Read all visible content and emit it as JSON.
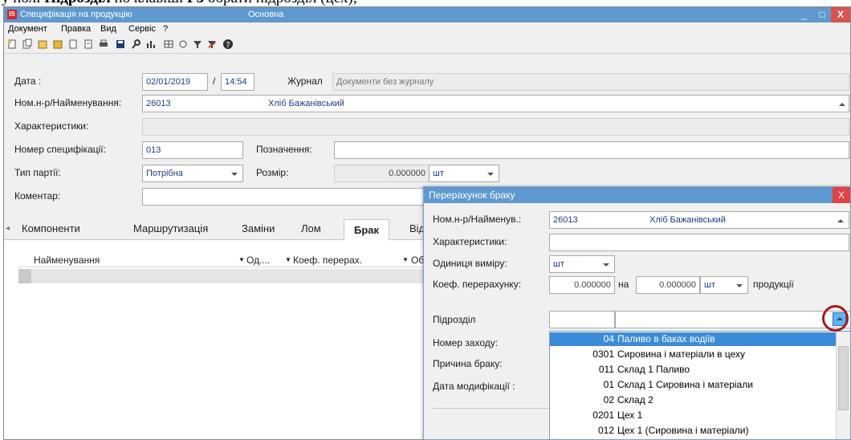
{
  "doc_strip": {
    "prefix": "у полі ",
    "bold": "Підрозділ",
    "middle": " по клавіші ",
    "bold2": "F3",
    "suffix": " обрати підрозділ (цех);"
  },
  "window": {
    "icon_text": "IS",
    "title": "Специфікація на продукцію",
    "subtitle": "Основна",
    "controls": {
      "min": "_",
      "max": "□",
      "close": "X"
    }
  },
  "menu": [
    "Документ",
    "Правка",
    "Вид",
    "Сервіс",
    "?"
  ],
  "toolbar_icons": [
    "new-doc-icon",
    "copy-doc-icon",
    "open-icon",
    "open-folder-icon",
    "doc-icon",
    "doc2-icon",
    "print-icon",
    "save-icon",
    "find-icon",
    "chart-icon",
    "grid-icon",
    "refresh-icon",
    "filter-icon",
    "clear-filter-icon",
    "help-icon"
  ],
  "form": {
    "date_label": "Дата :",
    "date_value": "02/01/2019",
    "time_sep": "/",
    "time_value": "14:54",
    "journal_label": "Журнал",
    "journal_value": "Документи без журналу",
    "item_label": "Ном.н-р/Найменування:",
    "item_code": "26013",
    "item_name": "Хліб Бажанівський",
    "characteristics_label": "Характеристики:",
    "spec_number_label": "Номер специфікації:",
    "spec_number_value": "013",
    "designation_label": "Позначення:",
    "batch_type_label": "Тип партії:",
    "batch_type_value": "Потрібна",
    "size_label": "Розмір:",
    "size_value": "0.000000",
    "size_unit": "шт",
    "comment_label": "Коментар:"
  },
  "tabs": [
    "Компоненти",
    "Маршрутизація",
    "Заміни",
    "Лом",
    "Брак",
    "Від"
  ],
  "active_tab": "Брак",
  "grid": {
    "columns": [
      "Найменування",
      "Од....",
      "Коеф. перерах.",
      "Об"
    ]
  },
  "dialog": {
    "title": "Перерахунок браку",
    "close": "X",
    "item_label": "Ном.н-р/Найменув.:",
    "item_code": "26013",
    "item_name": "Хліб Бажанівський",
    "characteristics_label": "Характеристики:",
    "unit_label": "Одиниця виміру:",
    "unit_value": "шт",
    "coef_label": "Коеф. перерахунку:",
    "coef_value": "0.000000",
    "on_label": "на",
    "qty_value": "0.000000",
    "qty_unit": "шт",
    "product_label": "продукції",
    "division_label": "Підрозділ",
    "visit_number_label": "Номер заходу:",
    "reject_reason_label": "Причина браку:",
    "modified_date_label": "Дата модифікації :",
    "division_list": [
      {
        "code": "04",
        "name": "Паливо в баках водіїв",
        "selected": true
      },
      {
        "code": "0301",
        "name": "Сировина і матеріали в цеху"
      },
      {
        "code": "011",
        "name": "Склад 1 Паливо"
      },
      {
        "code": "01",
        "name": "Склад 1 Сировина і матеріали"
      },
      {
        "code": "02",
        "name": "Склад 2"
      },
      {
        "code": "0201",
        "name": "Цех 1"
      },
      {
        "code": "012",
        "name": "Цех 1 (Сировина і матеріали)"
      }
    ]
  },
  "colors": {
    "title_bar": "#5f99cf",
    "selection": "#3c8bd8",
    "close": "#d9534f",
    "highlight_circle": "#a11c1c"
  }
}
